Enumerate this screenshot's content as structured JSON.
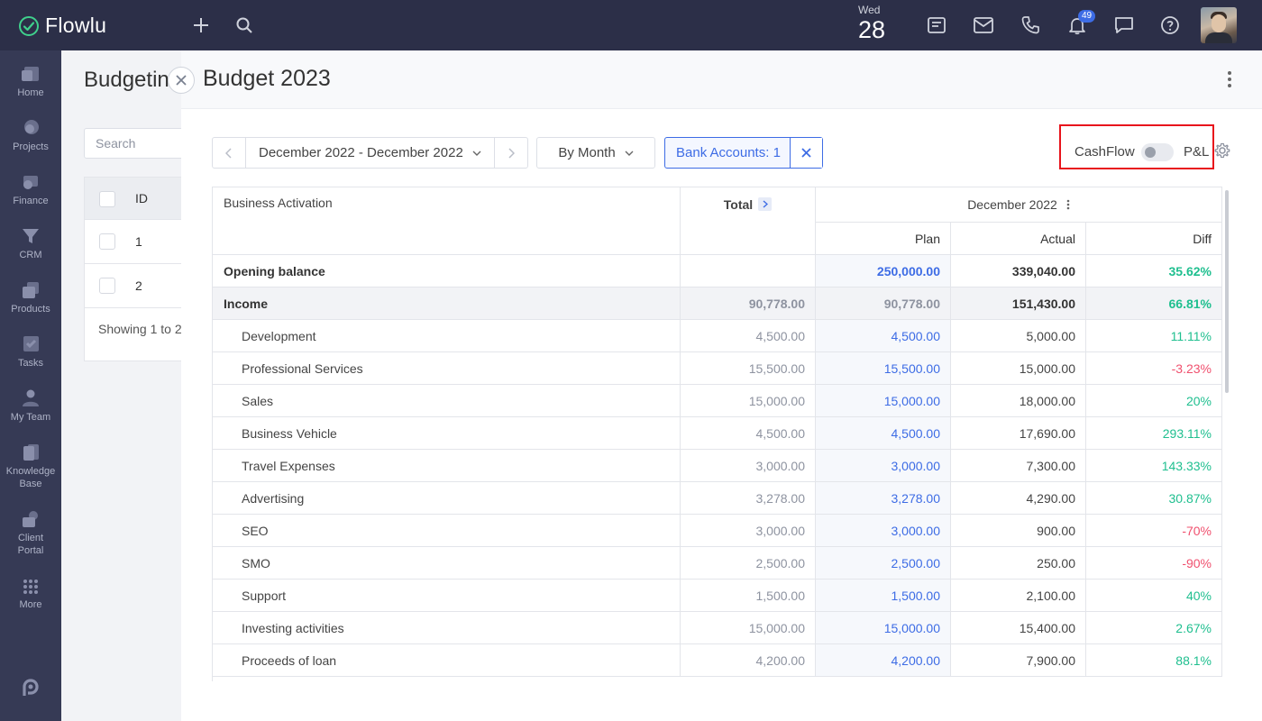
{
  "app": {
    "name": "Flowlu"
  },
  "topbar": {
    "date_day": "Wed",
    "date_num": "28",
    "notification_count": "49",
    "icons": [
      "plus-icon",
      "search-icon",
      "notes-icon",
      "mail-icon",
      "phone-icon",
      "bell-icon",
      "chat-icon",
      "help-icon"
    ]
  },
  "sidebar": {
    "items": [
      {
        "label": "Home",
        "icon": "home-icon"
      },
      {
        "label": "Projects",
        "icon": "projects-icon"
      },
      {
        "label": "Finance",
        "icon": "finance-icon"
      },
      {
        "label": "CRM",
        "icon": "crm-icon"
      },
      {
        "label": "Products",
        "icon": "products-icon"
      },
      {
        "label": "Tasks",
        "icon": "tasks-icon"
      },
      {
        "label": "My Team",
        "icon": "team-icon"
      },
      {
        "label": "Knowledge Base",
        "label_lines": [
          "Knowledge",
          "Base"
        ],
        "icon": "knowledge-icon"
      },
      {
        "label": "Client Portal",
        "label_lines": [
          "Client",
          "Portal"
        ],
        "icon": "portal-icon"
      },
      {
        "label": "More",
        "icon": "grid-icon"
      }
    ]
  },
  "background_page": {
    "title": "Budgetin",
    "search_placeholder": "Search",
    "column_id": "ID",
    "rows": [
      "1",
      "2"
    ],
    "showing": "Showing 1 to 2"
  },
  "panel": {
    "title": "Budget 2023",
    "date_range": "December 2022 - December 2022",
    "grouping": "By Month",
    "bank_filter": "Bank Accounts: 1",
    "cashflow_label": "CashFlow",
    "pl_label": "P&L",
    "toggle_on": false
  },
  "table": {
    "header_name": "Business Activation",
    "header_total": "Total",
    "header_period": "December 2022",
    "sub_headers": [
      "Plan",
      "Actual",
      "Diff"
    ],
    "rows": [
      {
        "name": "Opening balance",
        "total": "",
        "plan": "250,000.00",
        "actual": "339,040.00",
        "diff": "35.62%",
        "sign": "pos",
        "type": "bold"
      },
      {
        "name": "Income",
        "total": "90,778.00",
        "plan": "90,778.00",
        "actual": "151,430.00",
        "diff": "66.81%",
        "sign": "pos",
        "type": "income"
      },
      {
        "name": "Development",
        "total": "4,500.00",
        "plan": "4,500.00",
        "actual": "5,000.00",
        "diff": "11.11%",
        "sign": "pos",
        "type": "sub"
      },
      {
        "name": "Professional Services",
        "total": "15,500.00",
        "plan": "15,500.00",
        "actual": "15,000.00",
        "diff": "-3.23%",
        "sign": "neg",
        "type": "sub"
      },
      {
        "name": "Sales",
        "total": "15,000.00",
        "plan": "15,000.00",
        "actual": "18,000.00",
        "diff": "20%",
        "sign": "pos",
        "type": "sub"
      },
      {
        "name": "Business Vehicle",
        "total": "4,500.00",
        "plan": "4,500.00",
        "actual": "17,690.00",
        "diff": "293.11%",
        "sign": "pos",
        "type": "sub"
      },
      {
        "name": "Travel Expenses",
        "total": "3,000.00",
        "plan": "3,000.00",
        "actual": "7,300.00",
        "diff": "143.33%",
        "sign": "pos",
        "type": "sub"
      },
      {
        "name": "Advertising",
        "total": "3,278.00",
        "plan": "3,278.00",
        "actual": "4,290.00",
        "diff": "30.87%",
        "sign": "pos",
        "type": "sub"
      },
      {
        "name": "SEO",
        "total": "3,000.00",
        "plan": "3,000.00",
        "actual": "900.00",
        "diff": "-70%",
        "sign": "neg",
        "type": "sub"
      },
      {
        "name": "SMO",
        "total": "2,500.00",
        "plan": "2,500.00",
        "actual": "250.00",
        "diff": "-90%",
        "sign": "neg",
        "type": "sub"
      },
      {
        "name": "Support",
        "total": "1,500.00",
        "plan": "1,500.00",
        "actual": "2,100.00",
        "diff": "40%",
        "sign": "pos",
        "type": "sub"
      },
      {
        "name": "Investing activities",
        "total": "15,000.00",
        "plan": "15,000.00",
        "actual": "15,400.00",
        "diff": "2.67%",
        "sign": "pos",
        "type": "sub"
      },
      {
        "name": "Proceeds of loan",
        "total": "4,200.00",
        "plan": "4,200.00",
        "actual": "7,900.00",
        "diff": "88.1%",
        "sign": "pos",
        "type": "sub"
      }
    ]
  },
  "colors": {
    "topbar": "#2c2f48",
    "sidebar": "#363a55",
    "accent": "#3d6ce5",
    "positive": "#1fbf8f",
    "negative": "#f0506e",
    "highlight": "#e8141c"
  }
}
